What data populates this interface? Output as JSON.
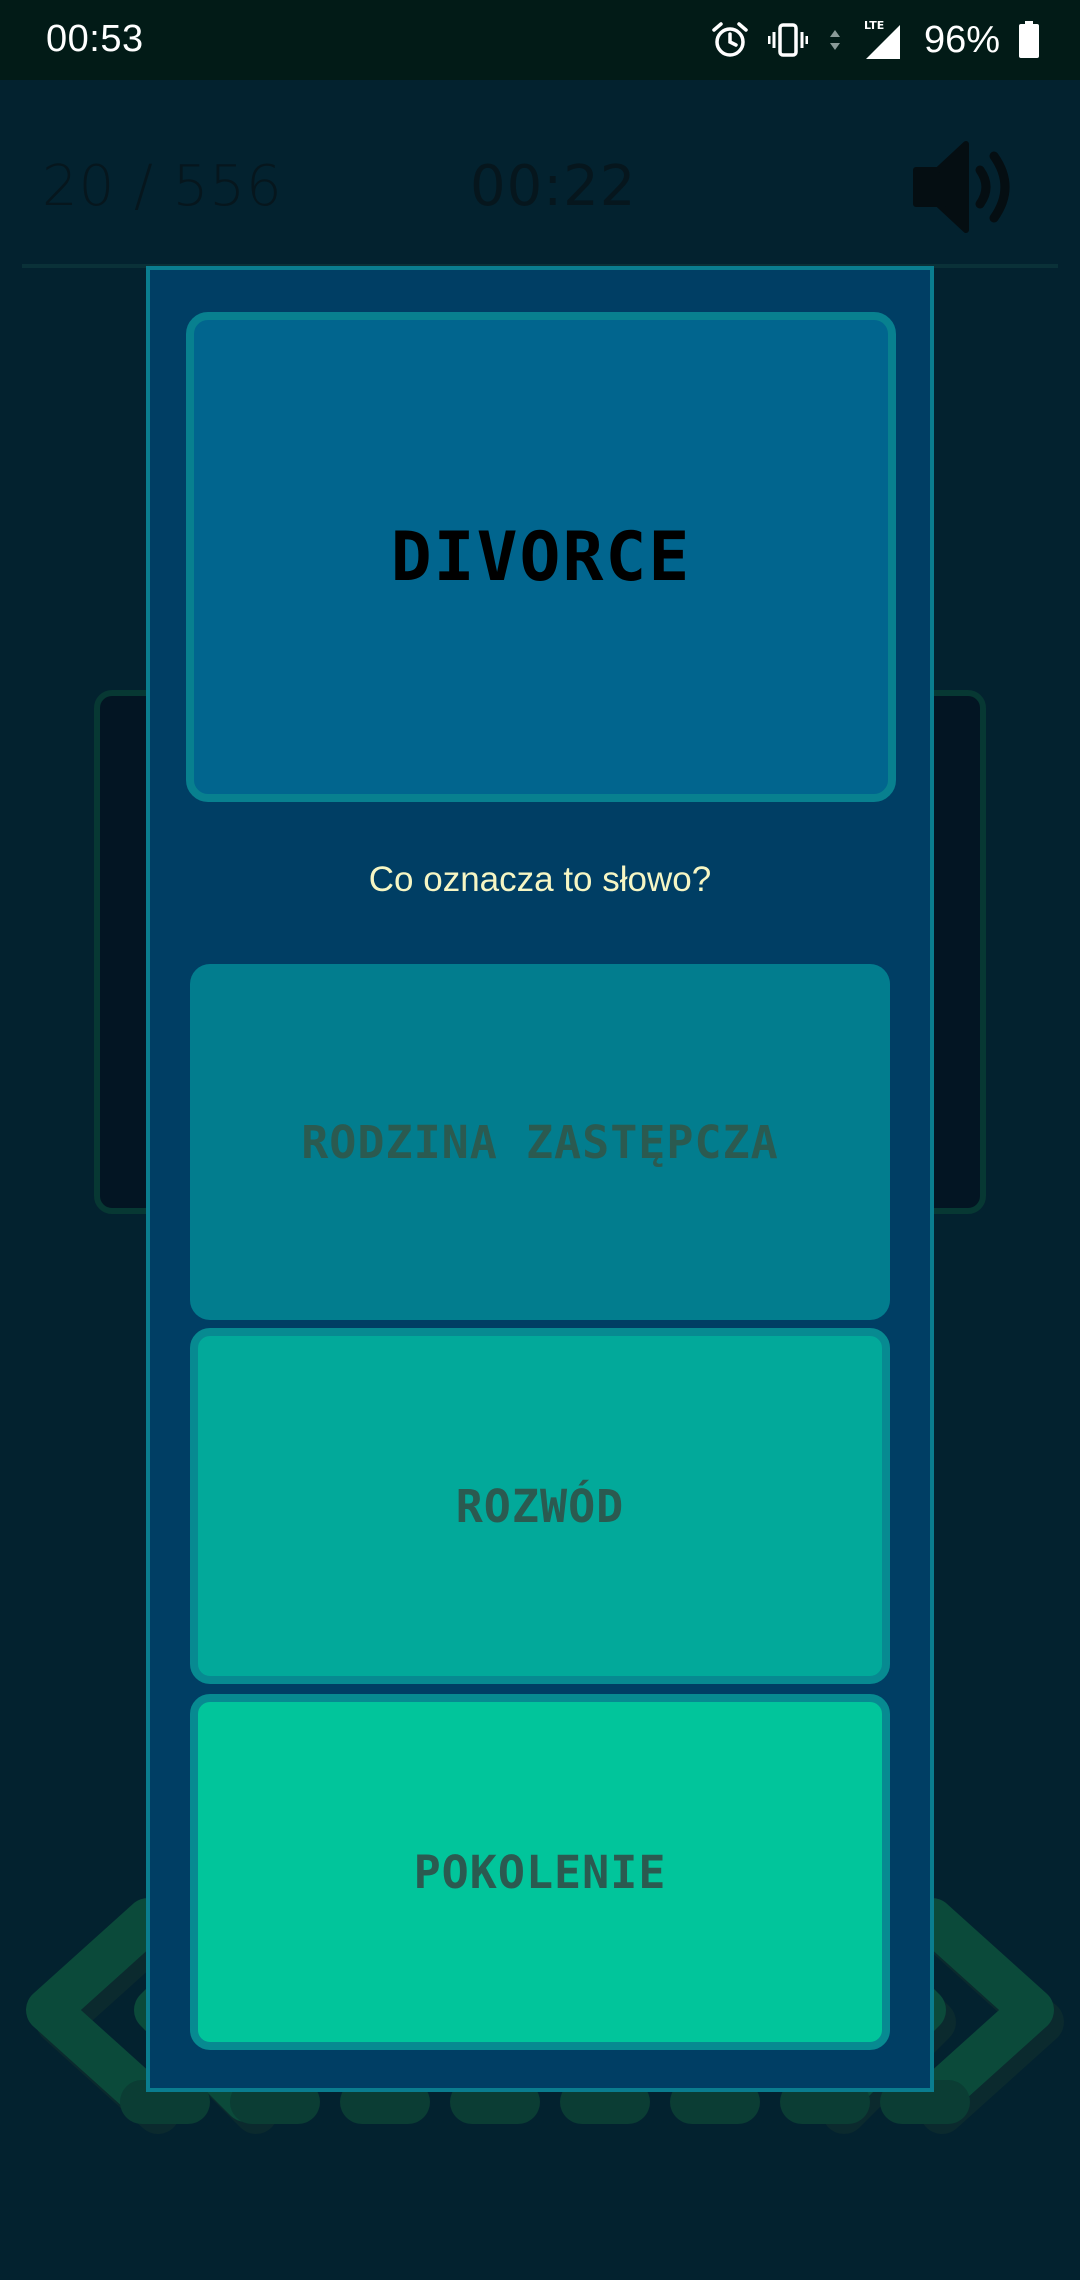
{
  "status_bar": {
    "time": "00:53",
    "network": "LTE",
    "battery": "96%",
    "icons": [
      "alarm-icon",
      "vibrate-icon",
      "lte-icon",
      "signal-icon",
      "battery-icon"
    ]
  },
  "header": {
    "counter": "20 / 556",
    "timer": "00:22",
    "sound_icon": "speaker-icon"
  },
  "dialog": {
    "word": "DIVORCE",
    "question": "Co oznacza to słowo?",
    "options": [
      {
        "label": "RODZINA ZASTĘPCZA"
      },
      {
        "label": "ROZWÓD"
      },
      {
        "label": "POKOLENIE"
      }
    ]
  },
  "colors": {
    "background": "#03222f",
    "dialog": "#003e64",
    "word_card": "#01658e",
    "option_1": "#027d8e",
    "option_2": "#02a99a",
    "option_3": "#01c59b",
    "question_text": "#f6f6c4"
  }
}
